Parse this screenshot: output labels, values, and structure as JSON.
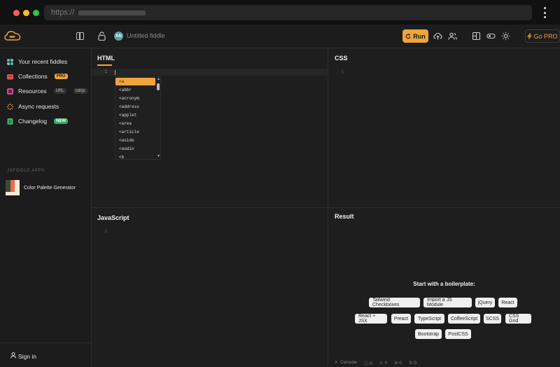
{
  "browser": {
    "url_prefix": "https://"
  },
  "topbar": {
    "avatar_initials": "AN",
    "fiddle_title": "Untitled fiddle",
    "run_label": "Run",
    "go_pro_label": "Go PRO"
  },
  "sidebar": {
    "items": [
      {
        "label": "Your recent fiddles",
        "color": "#4fb7c4"
      },
      {
        "label": "Collections",
        "badge": "PRO",
        "color": "#e0524f"
      },
      {
        "label": "Resources",
        "badge": "URL",
        "badge2": "cdnjs",
        "color": "#c8508e"
      },
      {
        "label": "Async requests",
        "color": "#e8a23a"
      },
      {
        "label": "Changelog",
        "badge": "NEW",
        "color": "#4caf6a"
      }
    ],
    "apps_heading": "JSFIDDLE APPS",
    "apps": [
      {
        "label": "Color Palette Generator"
      }
    ],
    "signin_label": "Sign in"
  },
  "panes": {
    "html": {
      "title": "HTML",
      "line": "1"
    },
    "css": {
      "title": "CSS",
      "line": "1"
    },
    "js": {
      "title": "JavaScript",
      "line": "1"
    },
    "result": {
      "title": "Result"
    }
  },
  "autocomplete": {
    "items": [
      "<a",
      "<abbr",
      "<acronym",
      "<address",
      "<applet",
      "<area",
      "<article",
      "<aside",
      "<audio",
      "<b"
    ]
  },
  "result": {
    "boilerplate_title": "Start with a boilerplate:",
    "chips": [
      "Tailwind Checkboxes",
      "Import a JS Module",
      "jQuery",
      "React",
      "React + JSX",
      "Preact",
      "TypeScript",
      "CoffeeScript",
      "SCSS",
      "CSS Grid",
      "Bootstrap",
      "PostCSS"
    ]
  },
  "console": {
    "label": "Console",
    "counts": [
      "0",
      "0",
      "0",
      "0"
    ]
  },
  "colors": {
    "accent": "#f0a43c"
  }
}
